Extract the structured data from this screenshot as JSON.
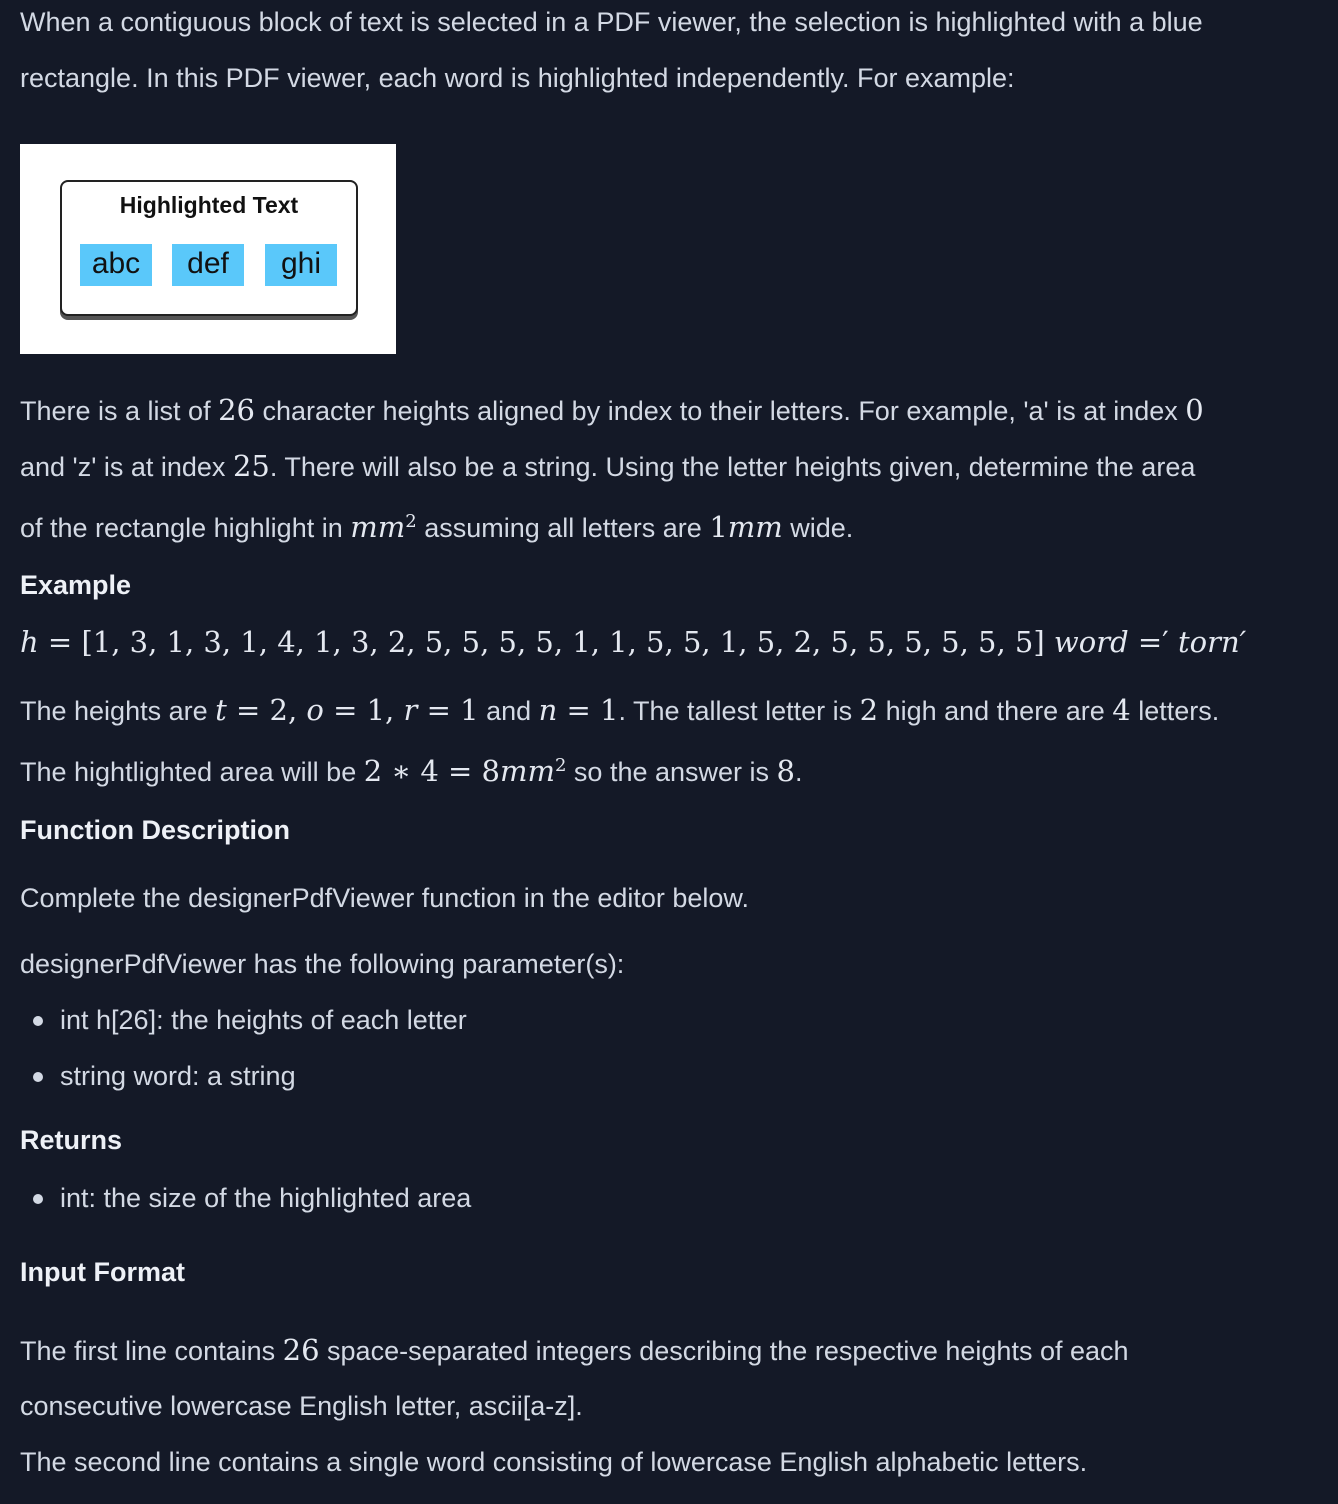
{
  "intro": {
    "line1": "When a contiguous block of text is selected in a PDF viewer, the selection is highlighted with a blue",
    "line2": "rectangle. In this PDF viewer, each word is highlighted independently. For example:"
  },
  "figure": {
    "title": "Highlighted Text",
    "words": [
      "abc",
      "def",
      "ghi"
    ],
    "highlight_color": "#5ac8fa"
  },
  "description": {
    "l1_a": "There is a list of ",
    "l1_n26": "26",
    "l1_b": " character heights aligned by index to their letters. For example, 'a' is at index ",
    "l1_n0": "0",
    "l2_a": "and 'z' is at index ",
    "l2_n25": "25",
    "l2_b": ". There will also be a string. Using the letter heights given, determine the area",
    "l3_a": "of the rectangle highlight in ",
    "l3_unit": "mm",
    "l3_sup": "2",
    "l3_b": " assuming all letters are ",
    "l3_width": "1",
    "l3_width_unit": "mm",
    "l3_c": " wide."
  },
  "example": {
    "heading": "Example",
    "h_var": "h",
    "h_eq": " = ",
    "h_list": "[1, 3, 1, 3, 1, 4, 1, 3, 2, 5, 5, 5, 5, 1, 1, 5, 5, 1, 5, 2, 5, 5, 5, 5, 5, 5]",
    "word_var": " word",
    "word_eq": " =′ ",
    "word_val": "torn′",
    "e1_a": "The heights are ",
    "e1_t": "t",
    "e1_teq": " = 2, ",
    "e1_o": "o",
    "e1_oeq": " = 1, ",
    "e1_r": "r",
    "e1_req": " = 1",
    "e1_and": " and ",
    "e1_n": "n",
    "e1_neq": " = 1",
    "e1_b": ". The tallest letter is ",
    "e1_tall": "2",
    "e1_c": " high and there are ",
    "e1_count": "4",
    "e1_d": " letters.",
    "e2_a": "The hightlighted area will be ",
    "e2_expr": "2 ∗ 4 = 8",
    "e2_unit": "mm",
    "e2_sup": "2",
    "e2_b": " so the answer is ",
    "e2_ans": "8",
    "e2_c": "."
  },
  "function_description": {
    "heading": "Function Description",
    "text": "Complete the designerPdfViewer function in the editor below.",
    "params_intro": "designerPdfViewer has the following parameter(s):",
    "params": [
      "int h[26]: the heights of each letter",
      "string word: a string"
    ]
  },
  "returns": {
    "heading": "Returns",
    "items": [
      "int: the size of the highlighted area"
    ]
  },
  "input_format": {
    "heading": "Input Format",
    "l1_a": "The first line contains ",
    "l1_n": "26",
    "l1_b": " space-separated integers describing the respective heights of each",
    "l2": "consecutive lowercase English letter, ascii[a-z].",
    "l3": "The second line contains a single word consisting of lowercase English alphabetic letters."
  }
}
